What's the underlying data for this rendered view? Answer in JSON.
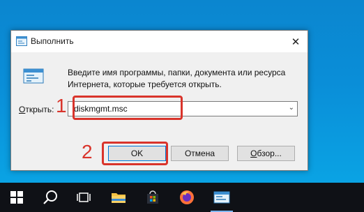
{
  "dialog": {
    "title": "Выполнить",
    "description": "Введите имя программы, папки, документа или ресурса Интернета, которые требуется открыть.",
    "open_label_accel": "О",
    "open_label_rest": "ткрыть:",
    "input_value": "diskmgmt.msc",
    "buttons": {
      "ok": "OK",
      "cancel": "Отмена",
      "browse_accel": "О",
      "browse_rest": "бзор..."
    }
  },
  "annotations": {
    "step1": "1",
    "step2": "2",
    "color": "#d9342b"
  },
  "taskbar": {
    "items": [
      "start-icon",
      "search-icon",
      "task-view-icon",
      "file-explorer-icon",
      "store-icon",
      "firefox-icon",
      "run-app-icon"
    ]
  }
}
